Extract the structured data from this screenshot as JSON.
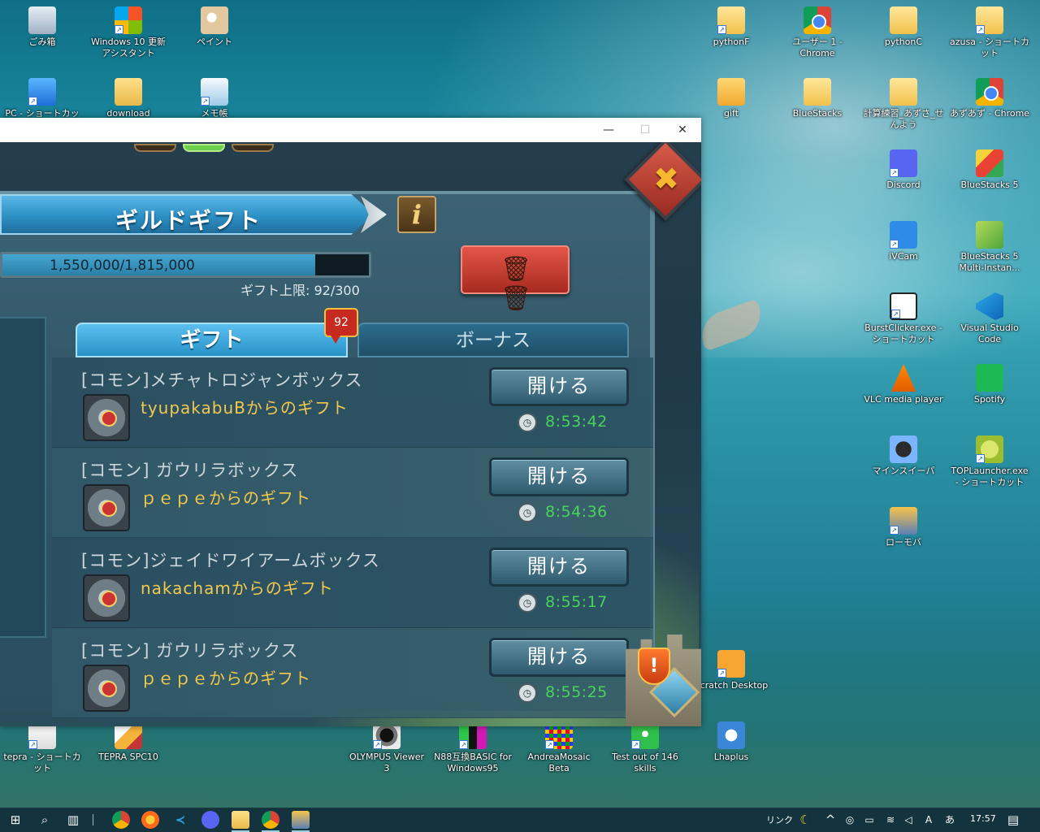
{
  "desktop": {
    "icons_left": [
      {
        "label": "ごみ箱",
        "icon": "recycle-bin-icon"
      },
      {
        "label": "Windows 10 更新アシスタント",
        "icon": "windows-update-icon"
      },
      {
        "label": "ペイント",
        "icon": "paint-icon"
      },
      {
        "label": "PC - ショートカット",
        "icon": "pc-icon"
      },
      {
        "label": "download",
        "icon": "zip-folder-icon"
      },
      {
        "label": "メモ帳",
        "icon": "notepad-icon"
      }
    ],
    "icons_right": [
      {
        "label": "pythonF",
        "icon": "folder-icon"
      },
      {
        "label": "ユーザー 1 - Chrome",
        "icon": "chrome-icon"
      },
      {
        "label": "pythonC",
        "icon": "folder-icon"
      },
      {
        "label": "azusa - ショートカット",
        "icon": "folder-icon"
      },
      {
        "label": "gift",
        "icon": "gift-file-icon"
      },
      {
        "label": "BlueStacks",
        "icon": "folder-icon"
      },
      {
        "label": "計算練習_あずさ_せんよう",
        "icon": "folder-icon"
      },
      {
        "label": "あずあず - Chrome",
        "icon": "chrome-icon"
      },
      {
        "label": "Discord",
        "icon": "discord-icon"
      },
      {
        "label": "BlueStacks 5",
        "icon": "bluestacks-icon"
      },
      {
        "label": "iVCam",
        "icon": "ivcam-icon"
      },
      {
        "label": "BlueStacks 5 Multi-Instan...",
        "icon": "bluestacks-multi-icon"
      },
      {
        "label": "BurstClicker.exe - ショートカット",
        "icon": "mouse-icon"
      },
      {
        "label": "Visual Studio Code",
        "icon": "vscode-icon"
      },
      {
        "label": "VLC media player",
        "icon": "vlc-icon"
      },
      {
        "label": "Spotify",
        "icon": "spotify-icon"
      },
      {
        "label": "マインスイーパ",
        "icon": "minesweeper-icon"
      },
      {
        "label": "TOPLauncher.exe - ショートカット",
        "icon": "toplauncher-icon"
      },
      {
        "label": "ローモバ",
        "icon": "lords-mobile-icon"
      },
      {
        "label": "Scratch Desktop",
        "icon": "scratch-icon"
      }
    ],
    "icons_bottom": [
      {
        "label": "tepra - ショートカット",
        "icon": "tepra-icon"
      },
      {
        "label": "TEPRA SPC10",
        "icon": "tepra-spc10-icon"
      },
      {
        "label": "OLYMPUS Viewer 3",
        "icon": "olympus-icon"
      },
      {
        "label": "N88互換BASIC for Windows95",
        "icon": "n88-basic-icon"
      },
      {
        "label": "AndreaMosaic Beta",
        "icon": "andreamosaic-icon"
      },
      {
        "label": "Test out of 146 skills",
        "icon": "test-skills-icon"
      },
      {
        "label": "Lhaplus",
        "icon": "lhaplus-icon"
      }
    ]
  },
  "window": {
    "controls": {
      "minimize": "—",
      "maximize": "☐",
      "close": "✕"
    }
  },
  "game": {
    "title": "ギルドギフト",
    "info_label": "i",
    "close_label": "✖",
    "progress": {
      "text": "1,550,000/1,815,000",
      "current": 1550000,
      "max": 1815000
    },
    "gift_limit": "ギフト上限: 92/300",
    "tabs": {
      "gift": "ギフト",
      "bonus": "ボーナス",
      "badge": "92"
    },
    "open_label": "開ける",
    "rows": [
      {
        "name": "[コモン]メチャトロジャンボックス",
        "from": "tyupakabuBからのギフト",
        "time": "8:53:42"
      },
      {
        "name": "[コモン] ガウリラボックス",
        "from": "ｐｅｐｅからのギフト",
        "time": "8:54:36"
      },
      {
        "name": "[コモン]ジェイドワイアームボックス",
        "from": "nakachamからのギフト",
        "time": "8:55:17"
      },
      {
        "name": "[コモン] ガウリラボックス",
        "from": "ｐｅｐｅからのギフト",
        "time": "8:55:25"
      }
    ],
    "alert_label": "!"
  },
  "taskbar": {
    "link_label": "リンク",
    "clock": "17:57",
    "apps": [
      "start-icon",
      "search-icon",
      "task-view-icon",
      "chrome-icon",
      "firefox-icon",
      "vscode-icon",
      "discord-icon",
      "explorer-icon",
      "chrome-icon",
      "lords-mobile-icon"
    ]
  }
}
